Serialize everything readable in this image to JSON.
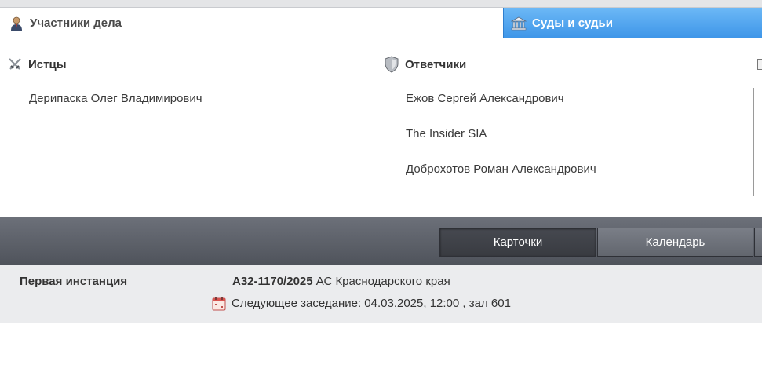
{
  "tabs": {
    "participants": {
      "label": "Участники дела",
      "icon": "person-icon"
    },
    "courts": {
      "label": "Суды и судьи",
      "icon": "courthouse-icon"
    }
  },
  "columns": {
    "plaintiffs": {
      "title": "Истцы",
      "icon": "crossed-swords-icon",
      "items": [
        "Дерипаска Олег Владимирович"
      ]
    },
    "defendants": {
      "title": "Ответчики",
      "icon": "shield-icon",
      "items": [
        "Ежов Сергей Александрович",
        "The Insider SIA",
        "Доброхотов Роман Александрович"
      ]
    }
  },
  "toolbar": {
    "cards_label": "Карточки",
    "calendar_label": "Календарь",
    "active": "cards"
  },
  "instance": {
    "label": "Первая инстанция",
    "case_number": "А32-1170/2025",
    "court": "АС Краснодарского края",
    "hearing_text": "Следующее заседание: 04.03.2025, 12:00 , зал 601",
    "hearing_icon": "calendar-icon"
  },
  "colors": {
    "active_tab": "#3d95e8",
    "toolbar_bg": "#5a5e66",
    "panel_bg": "#ebecee"
  }
}
